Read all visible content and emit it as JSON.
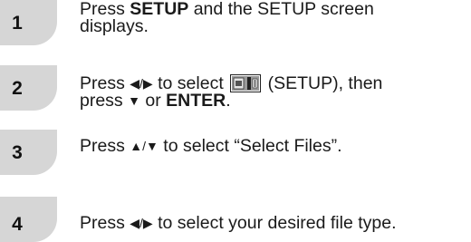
{
  "steps": [
    {
      "number": "1",
      "line1_pre": "Press ",
      "line1_bold": "SETUP",
      "line1_post": " and the SETUP screen",
      "line2": "displays."
    },
    {
      "number": "2",
      "line1_pre": "Press ",
      "line1_arrows": "◀/▶",
      "line1_mid": " to select ",
      "icon": "setup-icon",
      "line1_post": " (SETUP), then",
      "line2_pre": "press ",
      "line2_arrow": "▼",
      "line2_mid": " or ",
      "line2_bold": "ENTER",
      "line2_post": "."
    },
    {
      "number": "3",
      "line1_pre": "Press ",
      "line1_arrows": "▲/▼",
      "line1_post": " to select “Select Files”."
    },
    {
      "number": "4",
      "line1_pre": "Press ",
      "line1_arrows": "◀/▶",
      "line1_post": " to select your desired file type."
    }
  ]
}
